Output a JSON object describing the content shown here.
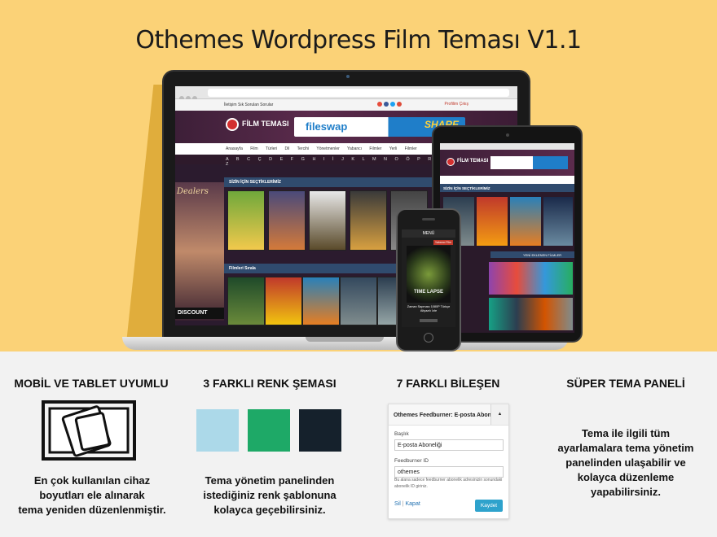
{
  "hero": {
    "title": "Othemes Wordpress Film Teması V1.1",
    "background_color": "#fbd277"
  },
  "laptop_site": {
    "top_links": "İletişim   Sık Sorulan Sorular",
    "top_right": "Profilim   Çıkış",
    "logo": "FİLM TEMASI",
    "ad_left": "fileswap",
    "ad_right": "SHARE",
    "nav": "Anasayfa Film Türleri Dil Tercihi Yönetmenler Yabancı Filmler Yerli Filmler",
    "alphabet": "A B C Ç D E F G H I İ J K L M N O Ö P R S Ş T U Ü V Y Z",
    "section_title": "SİZİN İÇİN SEÇTİKLERİMİZ",
    "sort_bar": "Filmleri Sırala",
    "new_added": "YENİ EKLENEN FİLMLER",
    "dealer": "Dealers",
    "discount": "DISCOUNT"
  },
  "tablet_site": {
    "logo": "FİLM TEMASI",
    "section_title": "SİZİN İÇİN SEÇTİKLERİMİZ",
    "new_added": "YENİ EKLENEN FİLMLER"
  },
  "phone_site": {
    "menu": "MENÜ",
    "badge": "Yabancı Film",
    "caption": "Zaman Sapması 1080P Türkçe Altyazılı İzle",
    "poster_title": "TIME LAPSE"
  },
  "features": [
    {
      "title": "MOBİL VE TABLET UYUMLU",
      "text_lines": [
        "En çok kullanılan cihaz",
        "boyutları ele alınarak",
        "tema yeniden düzenlenmiştir."
      ]
    },
    {
      "title": "3 FARKLI RENK ŞEMASI",
      "text_lines": [
        "Tema yönetim panelinden",
        "istediğiniz renk şablonuna",
        "kolayca geçebilirsiniz."
      ],
      "swatches": [
        "#acd9e9",
        "#1ea967",
        "#15212c"
      ]
    },
    {
      "title": "7 FARKLI BİLEŞEN",
      "widget": {
        "header": "Othemes Feedburner: E-posta Abone",
        "field1_label": "Başlık",
        "field1_value": "E-posta Aboneliği",
        "field2_label": "Feedburner ID",
        "field2_value": "othemes",
        "help": "Bu alana sadece feedburner abonelik adresinizin sonundaki abonelik ID giriniz.",
        "delete_link": "Sil",
        "close_link": "Kapat",
        "save_button": "Kaydet"
      }
    },
    {
      "title": "SÜPER TEMA PANELİ",
      "text_lines": [
        "Tema ile ilgili tüm",
        "ayarlamalara tema yönetim",
        "panelinden ulaşabilir ve",
        "kolayca düzenleme",
        "yapabilirsiniz."
      ]
    }
  ]
}
